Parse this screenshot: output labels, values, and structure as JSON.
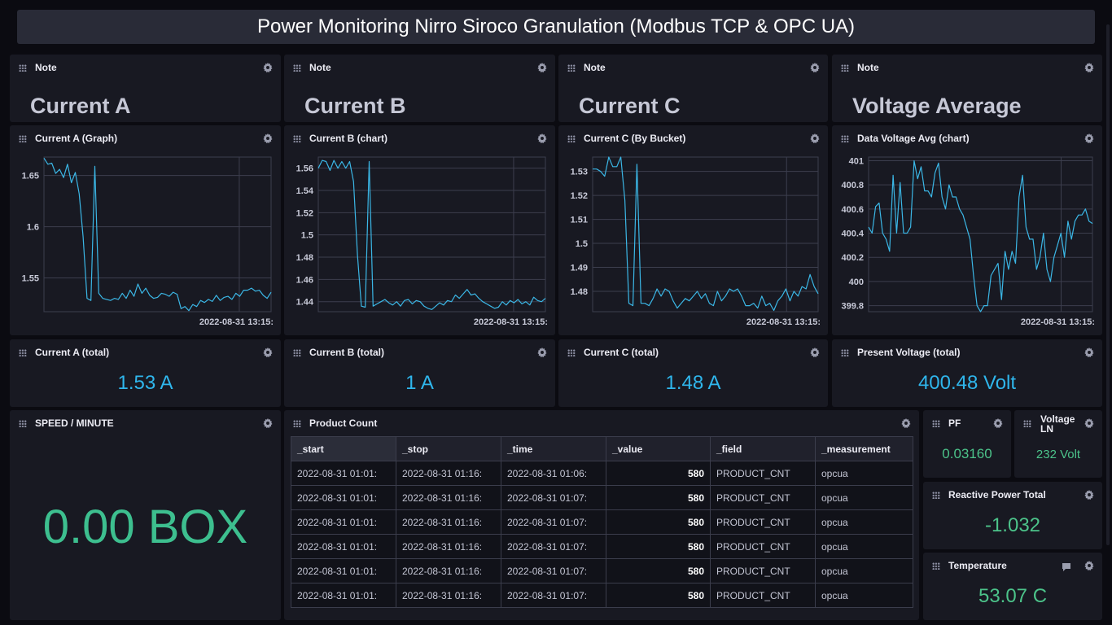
{
  "title": "Power Monitoring Nirro Siroco Granulation (Modbus TCP & OPC UA)",
  "notes": [
    {
      "title": "Note",
      "text": "Current A"
    },
    {
      "title": "Note",
      "text": "Current B"
    },
    {
      "title": "Note",
      "text": "Current C"
    },
    {
      "title": "Note",
      "text": "Voltage Average"
    }
  ],
  "graphs": [
    {
      "title": "Current A (Graph)",
      "time_label": "2022-08-31 13:15:",
      "chart_data": {
        "type": "line",
        "xlabel": "",
        "ylabel": "",
        "ylim": [
          1.517,
          1.668
        ],
        "yticks": [
          "1.55",
          "1.6",
          "1.65"
        ],
        "ytick_values": [
          1.55,
          1.6,
          1.65
        ],
        "grid": true,
        "color": "#3bb7e6",
        "values": [
          1.667,
          1.661,
          1.662,
          1.652,
          1.656,
          1.648,
          1.661,
          1.643,
          1.653,
          1.632,
          1.59,
          1.53,
          1.528,
          1.659,
          1.535,
          1.53,
          1.529,
          1.528,
          1.53,
          1.529,
          1.535,
          1.53,
          1.538,
          1.532,
          1.544,
          1.535,
          1.54,
          1.533,
          1.53,
          1.531,
          1.535,
          1.534,
          1.532,
          1.536,
          1.534,
          1.52,
          1.522,
          1.518,
          1.524,
          1.522,
          1.528,
          1.526,
          1.529,
          1.527,
          1.533,
          1.528,
          1.531,
          1.532,
          1.529,
          1.535,
          1.532,
          1.538,
          1.538,
          1.54,
          1.537,
          1.538,
          1.533,
          1.53,
          1.536
        ]
      }
    },
    {
      "title": "Current B (chart)",
      "time_label": "2022-08-31 13:15:",
      "chart_data": {
        "type": "line",
        "xlabel": "",
        "ylabel": "",
        "ylim": [
          1.431,
          1.57
        ],
        "yticks": [
          "1.44",
          "1.46",
          "1.48",
          "1.5",
          "1.52",
          "1.54",
          "1.56"
        ],
        "ytick_values": [
          1.44,
          1.46,
          1.48,
          1.5,
          1.52,
          1.54,
          1.56
        ],
        "grid": true,
        "color": "#3bb7e6",
        "values": [
          1.56,
          1.567,
          1.566,
          1.558,
          1.567,
          1.56,
          1.566,
          1.56,
          1.566,
          1.548,
          1.482,
          1.436,
          1.435,
          1.566,
          1.436,
          1.438,
          1.44,
          1.442,
          1.439,
          1.437,
          1.44,
          1.436,
          1.441,
          1.442,
          1.438,
          1.441,
          1.44,
          1.436,
          1.434,
          1.433,
          1.436,
          1.439,
          1.437,
          1.441,
          1.44,
          1.446,
          1.443,
          1.447,
          1.451,
          1.446,
          1.447,
          1.443,
          1.44,
          1.438,
          1.436,
          1.434,
          1.435,
          1.44,
          1.437,
          1.441,
          1.439,
          1.442,
          1.438,
          1.44,
          1.437,
          1.444,
          1.441,
          1.44,
          1.443
        ]
      }
    },
    {
      "title": "Current C (By Bucket)",
      "time_label": "2022-08-31 13:15:",
      "chart_data": {
        "type": "line",
        "xlabel": "",
        "ylabel": "",
        "ylim": [
          1.4715,
          1.536
        ],
        "yticks": [
          "1.48",
          "1.49",
          "1.5",
          "1.51",
          "1.52",
          "1.53"
        ],
        "ytick_values": [
          1.48,
          1.49,
          1.5,
          1.51,
          1.52,
          1.53
        ],
        "grid": true,
        "color": "#3bb7e6",
        "values": [
          1.531,
          1.531,
          1.53,
          1.528,
          1.536,
          1.532,
          1.532,
          1.536,
          1.518,
          1.475,
          1.474,
          1.533,
          1.475,
          1.475,
          1.474,
          1.477,
          1.481,
          1.478,
          1.481,
          1.48,
          1.476,
          1.473,
          1.475,
          1.477,
          1.476,
          1.478,
          1.48,
          1.477,
          1.479,
          1.475,
          1.474,
          1.48,
          1.476,
          1.478,
          1.481,
          1.48,
          1.481,
          1.478,
          1.474,
          1.474,
          1.475,
          1.473,
          1.478,
          1.474,
          1.475,
          1.472,
          1.476,
          1.478,
          1.481,
          1.476,
          1.48,
          1.478,
          1.482,
          1.481,
          1.487,
          1.482,
          1.479
        ]
      }
    },
    {
      "title": "Data Voltage Avg (chart)",
      "time_label": "2022-08-31 13:15:",
      "chart_data": {
        "type": "line",
        "xlabel": "",
        "ylabel": "",
        "ylim": [
          399.75,
          401.03
        ],
        "yticks": [
          "399.8",
          "400",
          "400.2",
          "400.4",
          "400.6",
          "400.8",
          "401"
        ],
        "ytick_values": [
          399.8,
          400.0,
          400.2,
          400.4,
          400.6,
          400.8,
          401.0
        ],
        "grid": true,
        "color": "#3bb7e6",
        "values": [
          400.45,
          400.4,
          400.62,
          400.65,
          400.4,
          400.35,
          400.25,
          400.88,
          400.4,
          400.82,
          400.4,
          400.4,
          400.45,
          401.0,
          400.85,
          400.95,
          400.75,
          400.75,
          400.7,
          400.9,
          400.98,
          400.7,
          400.6,
          400.8,
          400.7,
          400.7,
          400.6,
          400.55,
          400.45,
          400.35,
          400.05,
          399.8,
          399.75,
          399.8,
          399.8,
          400.05,
          400.1,
          400.15,
          399.85,
          400.25,
          400.1,
          400.25,
          400.15,
          400.7,
          400.88,
          400.45,
          400.35,
          400.35,
          400.1,
          400.2,
          400.4,
          400.1,
          400.0,
          400.2,
          400.3,
          400.4,
          400.2,
          400.5,
          400.35,
          400.5,
          400.55,
          400.55,
          400.6,
          400.5,
          400.48
        ]
      }
    }
  ],
  "totals": [
    {
      "title": "Current A (total)",
      "value": "1.53 A"
    },
    {
      "title": "Current B (total)",
      "value": "1 A"
    },
    {
      "title": "Current C (total)",
      "value": "1.48 A"
    },
    {
      "title": "Present Voltage (total)",
      "value": "400.48 Volt"
    }
  ],
  "speed": {
    "title": "SPEED / MINUTE",
    "value": "0.00 BOX"
  },
  "product_count": {
    "title": "Product Count",
    "columns": [
      "_start",
      "_stop",
      "_time",
      "_value",
      "_field",
      "_measurement"
    ],
    "rows": [
      [
        "2022-08-31 01:01:",
        "2022-08-31 01:16:",
        "2022-08-31 01:06:",
        "580",
        "PRODUCT_CNT",
        "opcua"
      ],
      [
        "2022-08-31 01:01:",
        "2022-08-31 01:16:",
        "2022-08-31 01:07:",
        "580",
        "PRODUCT_CNT",
        "opcua"
      ],
      [
        "2022-08-31 01:01:",
        "2022-08-31 01:16:",
        "2022-08-31 01:07:",
        "580",
        "PRODUCT_CNT",
        "opcua"
      ],
      [
        "2022-08-31 01:01:",
        "2022-08-31 01:16:",
        "2022-08-31 01:07:",
        "580",
        "PRODUCT_CNT",
        "opcua"
      ],
      [
        "2022-08-31 01:01:",
        "2022-08-31 01:16:",
        "2022-08-31 01:07:",
        "580",
        "PRODUCT_CNT",
        "opcua"
      ],
      [
        "2022-08-31 01:01:",
        "2022-08-31 01:16:",
        "2022-08-31 01:07:",
        "580",
        "PRODUCT_CNT",
        "opcua"
      ]
    ]
  },
  "pf": {
    "title": "PF",
    "value": "0.03160"
  },
  "voltage_ln": {
    "title_line1": "Voltage",
    "title_line2": "LN",
    "value": "232 Volt"
  },
  "reactive_power": {
    "title": "Reactive Power Total",
    "value": "-1.032"
  },
  "temperature": {
    "title": "Temperature",
    "value": "53.07 C"
  },
  "colors": {
    "accent_blue": "#2fb6ec",
    "accent_green": "#4cc38a",
    "line": "#3bb7e6",
    "cell_bg": "#181922",
    "page_bg": "#0b0b11"
  }
}
